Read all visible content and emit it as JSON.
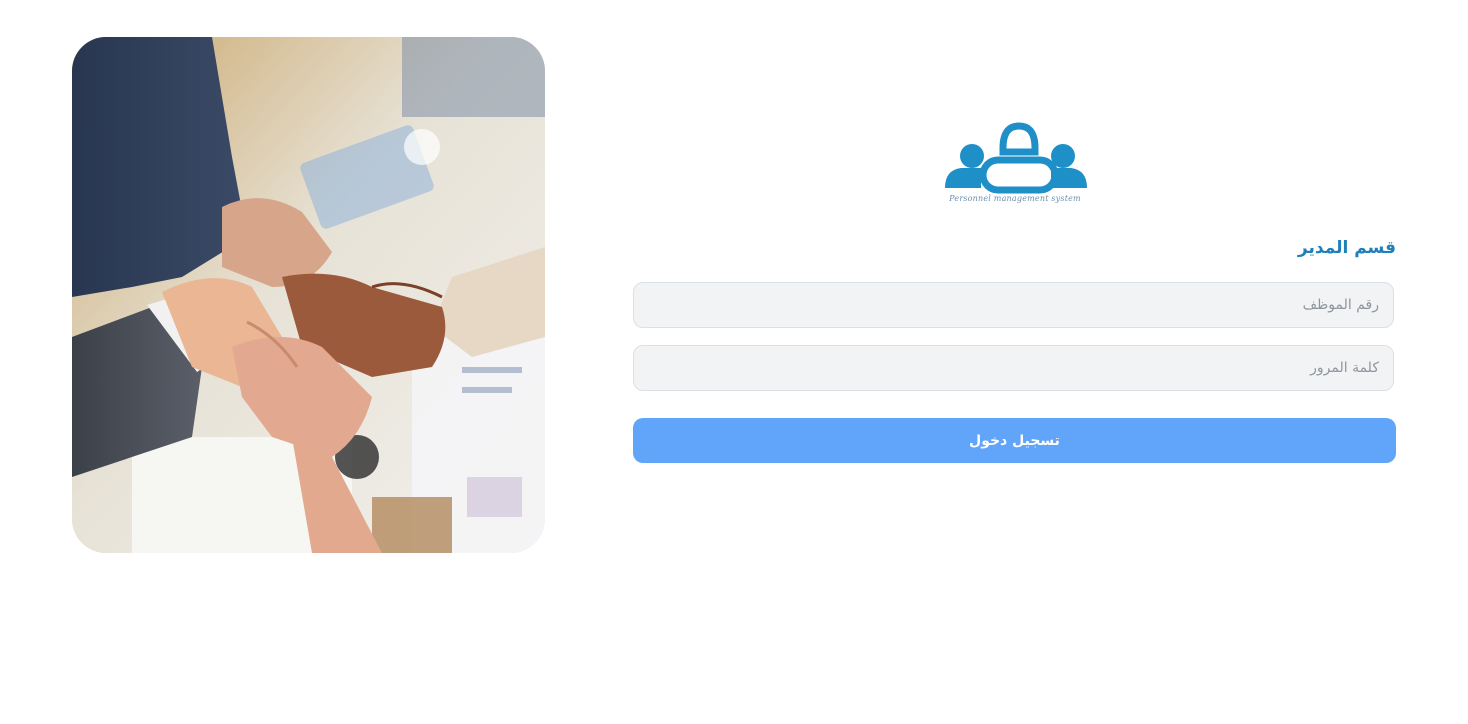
{
  "logo": {
    "icon": "people-group-icon",
    "caption": "Personnel management system",
    "color": "#1f8fc8"
  },
  "form": {
    "section_title": "قسم المدير",
    "employee_id_placeholder": "رقم الموظف",
    "employee_id_value": "",
    "password_placeholder": "كلمة المرور",
    "password_value": "",
    "login_label": "تسجيل دخول"
  },
  "colors": {
    "accent": "#60a5fa",
    "title": "#1f7fb8",
    "field_bg": "#f2f3f5"
  }
}
